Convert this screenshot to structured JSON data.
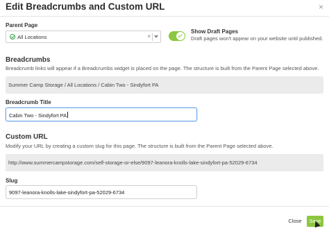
{
  "dialog": {
    "title": "Edit Breadcrumbs and Custom URL",
    "close_glyph": "×"
  },
  "parent_page": {
    "label": "Parent Page",
    "selected_value": "All Locations",
    "clear_glyph": "×",
    "icon": "check-circle-icon"
  },
  "draft_toggle": {
    "title": "Show Draft Pages",
    "description": "Draft pages won't appear on your website until published.",
    "on": true,
    "color": "#8dc63f"
  },
  "breadcrumbs": {
    "heading": "Breadcrumbs",
    "help": "Breadcrumb links will appear if a Breadcrumbs widget is placed on the page. The structure is built from the Parent Page selected above.",
    "preview": "Summer Camp Storage / All Locations / Cabin Two - Sindyfort PA"
  },
  "breadcrumb_title": {
    "label": "Breadcrumb Title",
    "value": "Cabin Two - Sindyfort PA"
  },
  "custom_url": {
    "heading": "Custom URL",
    "help": "Modify your URL by creating a custom slug for this page. The structure is built from the Parent Page selected above.",
    "preview": "http://www.summercampstorage.com/self-storage-or-else/9097-leanora-knolls-lake-sindyfort-pa-52029-6734"
  },
  "slug": {
    "label": "Slug",
    "value": "9097-leanora-knolls-lake-sindyfort-pa-52029-6734"
  },
  "footer": {
    "close_label": "Close",
    "save_label": "Save",
    "save_color": "#8dc63f"
  }
}
